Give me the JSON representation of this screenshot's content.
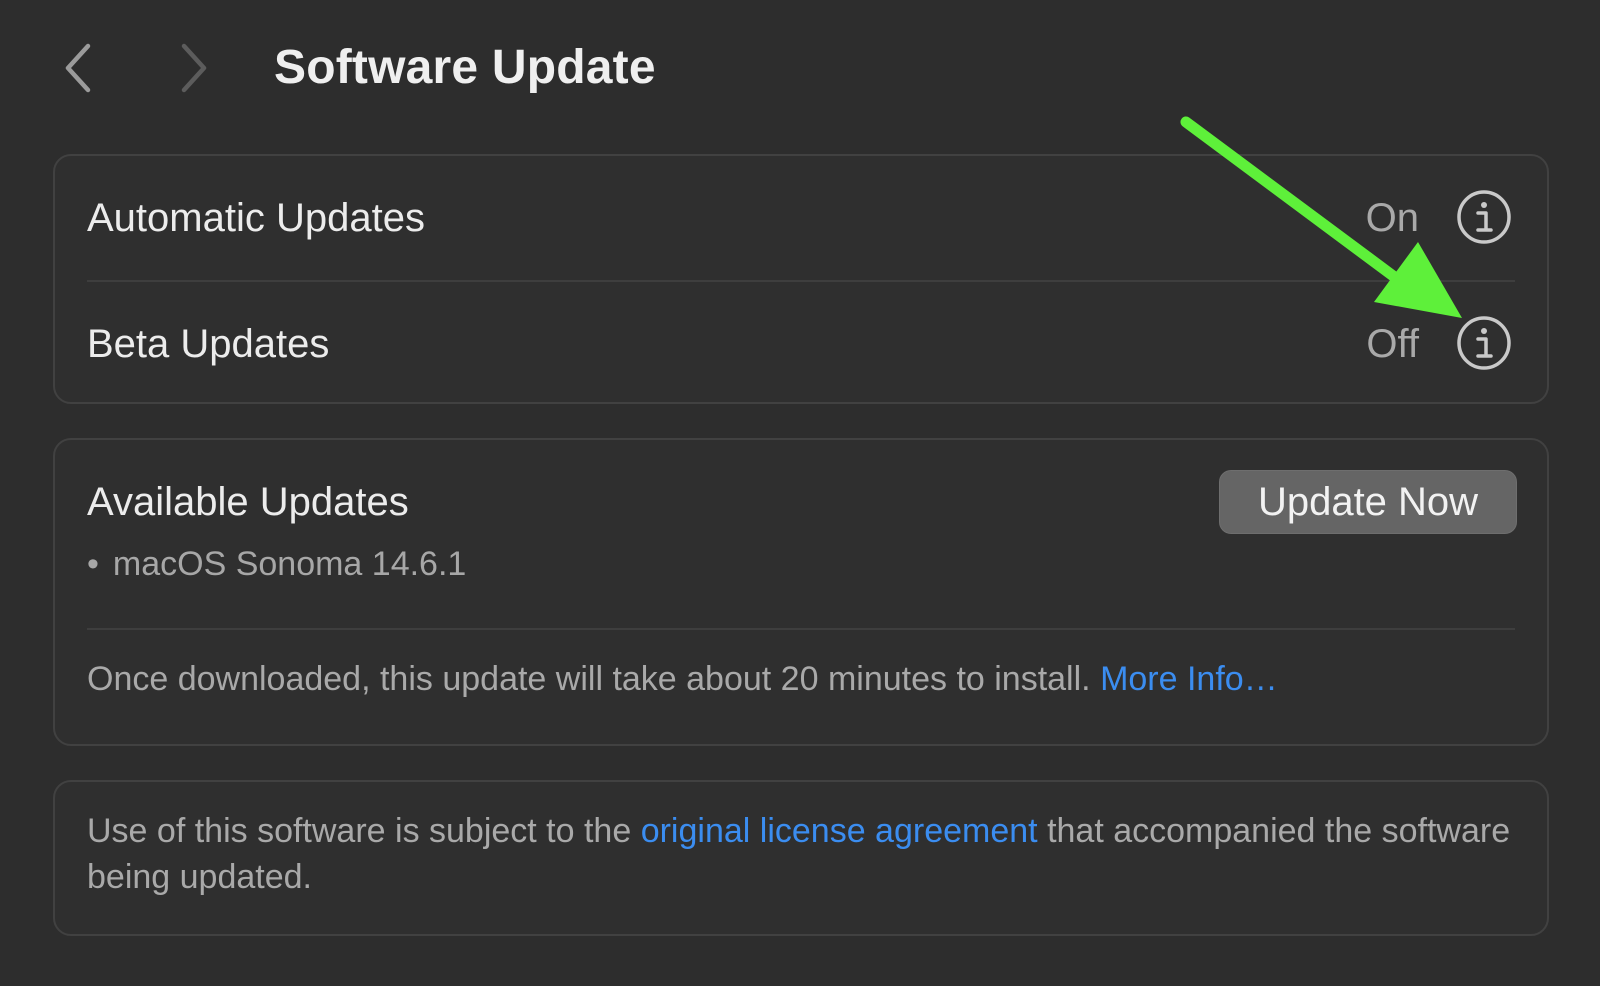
{
  "header": {
    "title": "Software Update",
    "back_icon": "chevron-left-icon",
    "forward_icon": "chevron-right-icon"
  },
  "settings": {
    "automatic_updates": {
      "label": "Automatic Updates",
      "value": "On",
      "icon": "info-icon"
    },
    "beta_updates": {
      "label": "Beta Updates",
      "value": "Off",
      "icon": "info-icon"
    }
  },
  "available_updates": {
    "title": "Available Updates",
    "bullet": "•",
    "item": "macOS Sonoma 14.6.1",
    "button_label": "Update Now",
    "note": "Once downloaded, this update will take about 20 minutes to install.",
    "more_info_link": "More Info…"
  },
  "license": {
    "text_before": "Use of this software is subject to the",
    "link_text": "original license agreement",
    "text_after": "that accompanied the software being updated."
  },
  "colors": {
    "background": "#2d2d2d",
    "card_border": "#414141",
    "link": "#3b8df0",
    "annotation_arrow": "#5ef03a",
    "button": "#656565"
  }
}
